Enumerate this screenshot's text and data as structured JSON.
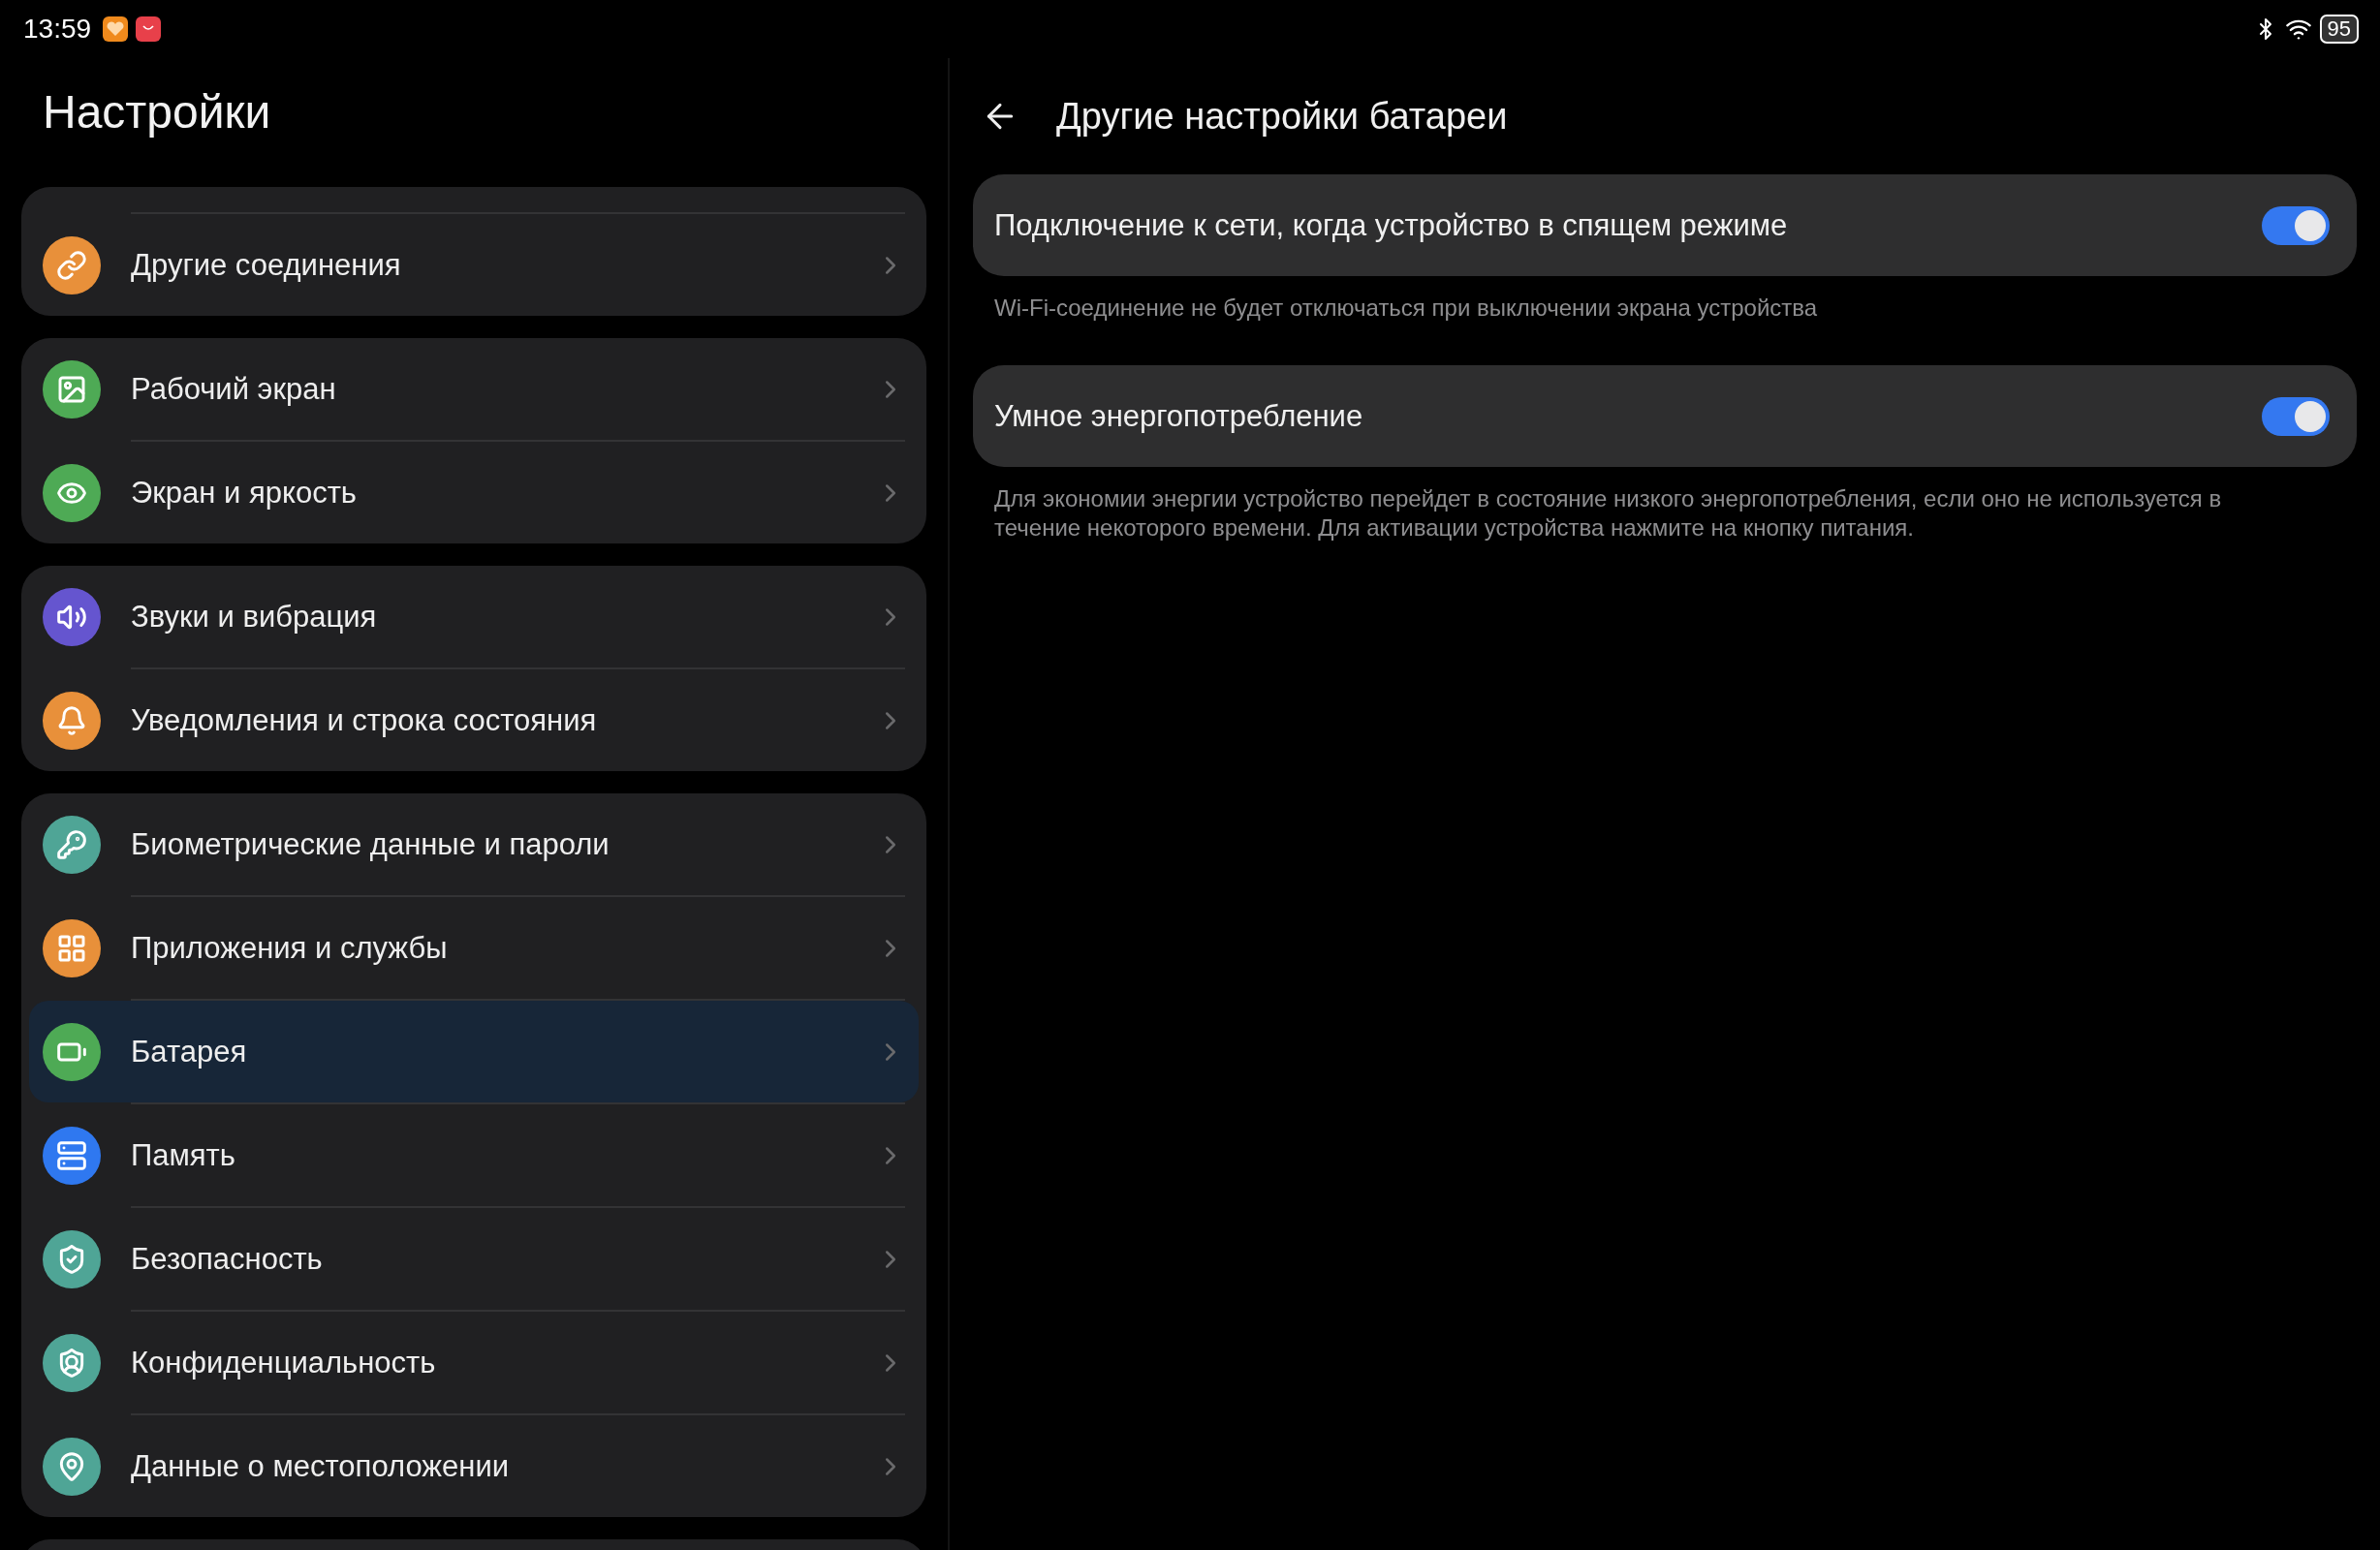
{
  "status_bar": {
    "time": "13:59",
    "battery": "95"
  },
  "sidebar": {
    "title": "Настройки",
    "groups": [
      {
        "items": [
          {
            "label": "Другие соединения",
            "color": "#e8903a",
            "selected": false
          }
        ]
      },
      {
        "items": [
          {
            "label": "Рабочий экран",
            "color": "#4eaa55",
            "selected": false
          },
          {
            "label": "Экран и яркость",
            "color": "#4eaa55",
            "selected": false
          }
        ]
      },
      {
        "items": [
          {
            "label": "Звуки и вибрация",
            "color": "#6555cf",
            "selected": false
          },
          {
            "label": "Уведомления и строка состояния",
            "color": "#e8903a",
            "selected": false
          }
        ]
      },
      {
        "items": [
          {
            "label": "Биометрические данные и пароли",
            "color": "#4fa596",
            "selected": false
          },
          {
            "label": "Приложения и службы",
            "color": "#e8903a",
            "selected": false
          },
          {
            "label": "Батарея",
            "color": "#4eaa55",
            "selected": true
          },
          {
            "label": "Память",
            "color": "#2f78f0",
            "selected": false
          },
          {
            "label": "Безопасность",
            "color": "#4fa596",
            "selected": false
          },
          {
            "label": "Конфиденциальность",
            "color": "#4fa596",
            "selected": false
          },
          {
            "label": "Данные о местоположении",
            "color": "#4fa596",
            "selected": false
          }
        ]
      }
    ]
  },
  "detail": {
    "title": "Другие настройки батареи",
    "settings": [
      {
        "label": "Подключение к сети, когда устройство в спящем режиме",
        "on": true,
        "description": "Wi-Fi-соединение не будет отключаться при выключении экрана устройства"
      },
      {
        "label": "Умное энергопотребление",
        "on": true,
        "description": "Для экономии энергии устройство перейдет в состояние низкого энергопотребления, если оно не используется в течение некоторого времени. Для активации устройства нажмите на кнопку питания."
      }
    ]
  }
}
